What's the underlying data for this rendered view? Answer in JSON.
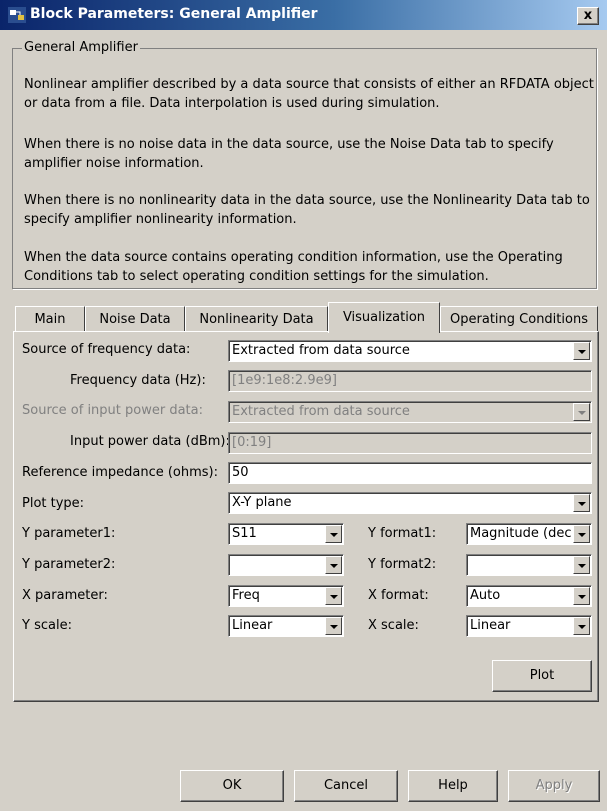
{
  "window": {
    "title": "Block Parameters: General Amplifier",
    "close_label": "x"
  },
  "description": {
    "group_title": "General Amplifier",
    "paragraphs": [
      "Nonlinear amplifier described by a data source that consists of either an RFDATA object or data from a file. Data interpolation is used during simulation.",
      "When there is no noise data in the data source, use the Noise Data tab to specify amplifier noise information.",
      "When there is no nonlinearity data in the data source, use the Nonlinearity Data tab to specify amplifier nonlinearity information.",
      "When the data source contains operating condition information, use the Operating Conditions tab to select operating condition settings for the simulation."
    ]
  },
  "tabs": [
    {
      "label": "Main"
    },
    {
      "label": "Noise Data"
    },
    {
      "label": "Nonlinearity Data"
    },
    {
      "label": "Visualization",
      "active": true
    },
    {
      "label": "Operating Conditions"
    }
  ],
  "form": {
    "source_freq_label": "Source of frequency data:",
    "source_freq_value": "Extracted from data source",
    "freq_data_label": "Frequency data (Hz):",
    "freq_data_value": "[1e9:1e8:2.9e9]",
    "source_power_label": "Source of input power data:",
    "source_power_value": "Extracted from data source",
    "power_data_label": "Input power data (dBm):",
    "power_data_value": "[0:19]",
    "ref_imp_label": "Reference impedance (ohms):",
    "ref_imp_value": "50",
    "plot_type_label": "Plot type:",
    "plot_type_value": "X-Y plane",
    "y_param1_label": "Y parameter1:",
    "y_param1_value": "S11",
    "y_format1_label": "Y format1:",
    "y_format1_value": "Magnitude (dec",
    "y_param2_label": "Y parameter2:",
    "y_param2_value": "",
    "y_format2_label": "Y format2:",
    "y_format2_value": "",
    "x_param_label": "X parameter:",
    "x_param_value": "Freq",
    "x_format_label": "X format:",
    "x_format_value": "Auto",
    "y_scale_label": "Y scale:",
    "y_scale_value": "Linear",
    "x_scale_label": "X scale:",
    "x_scale_value": "Linear"
  },
  "buttons": {
    "plot": "Plot",
    "ok": "OK",
    "cancel": "Cancel",
    "help": "Help",
    "apply": "Apply"
  }
}
